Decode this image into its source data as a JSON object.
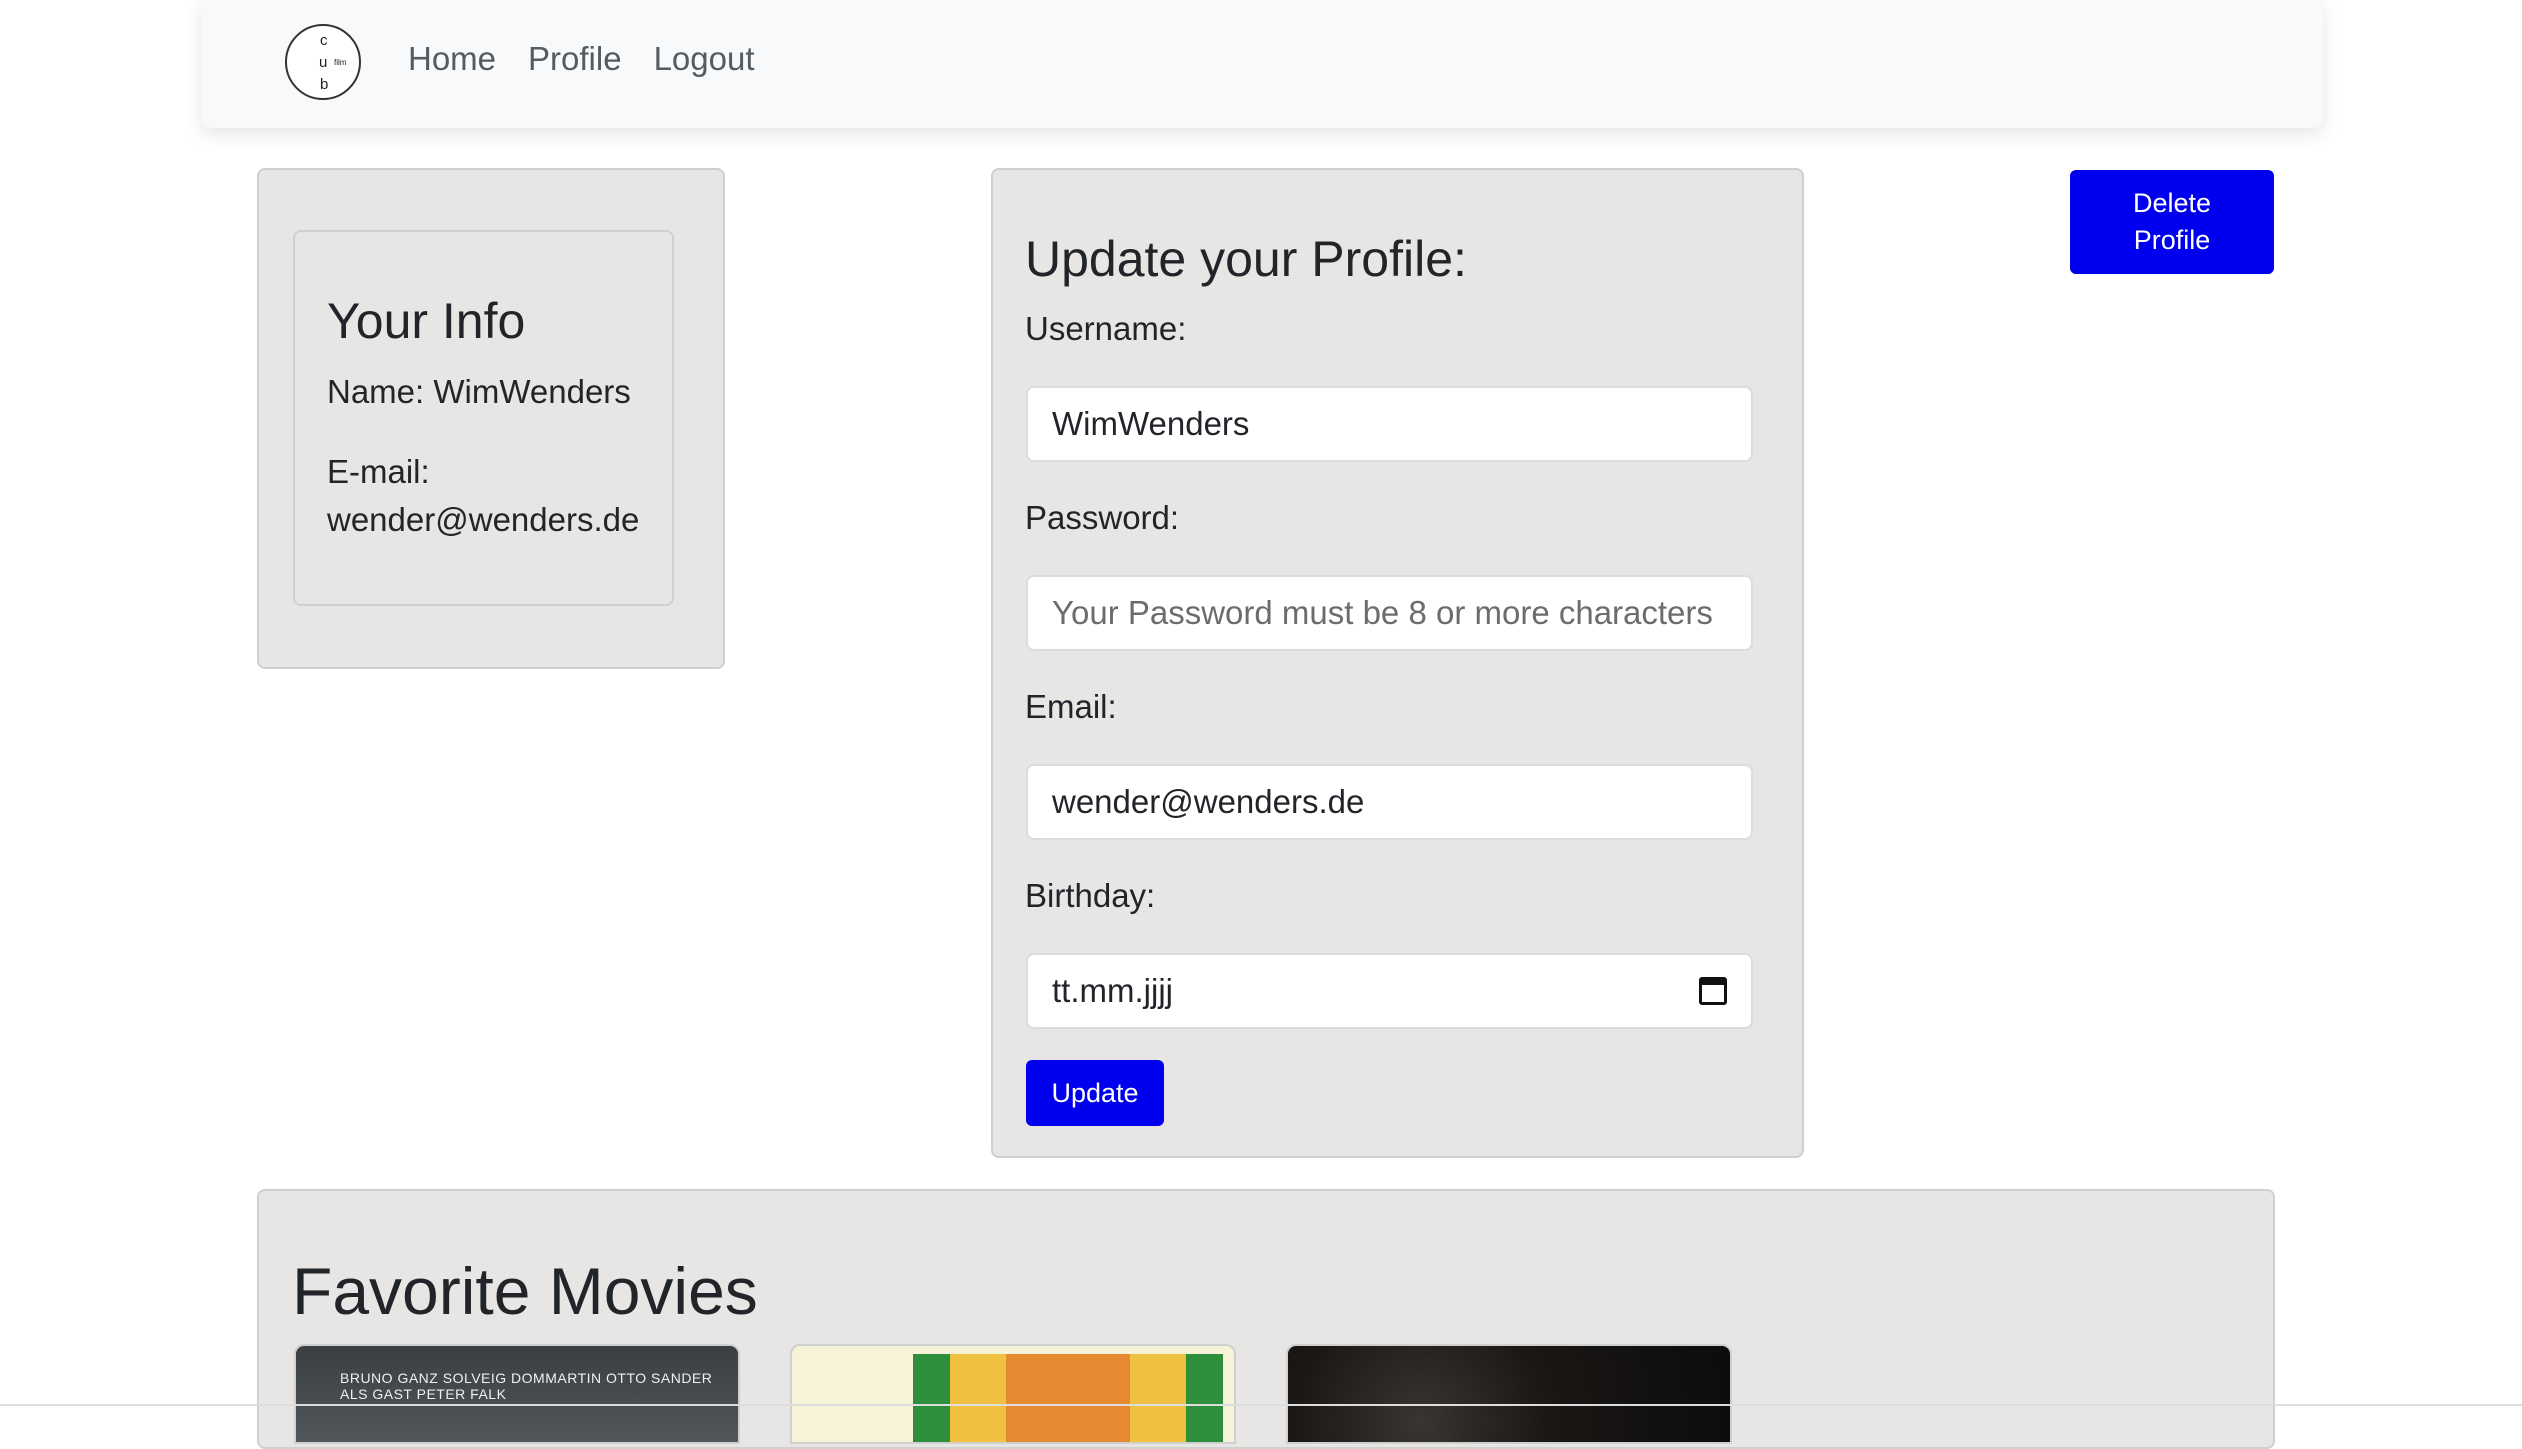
{
  "navbar": {
    "logo": {
      "letters": [
        "c",
        "u",
        "b"
      ],
      "small": "film"
    },
    "links": [
      "Home",
      "Profile",
      "Logout"
    ]
  },
  "info": {
    "title": "Your Info",
    "name_line": "Name: WimWenders",
    "email_label": "E-mail:",
    "email_value": "wender@wenders.de"
  },
  "form": {
    "title": "Update your Profile:",
    "username_label": "Username:",
    "username_value": "WimWenders",
    "password_label": "Password:",
    "password_placeholder": "Your Password must be 8 or more characters",
    "email_label": "Email:",
    "email_value": "wender@wenders.de",
    "birthday_label": "Birthday:",
    "birthday_placeholder": "tt.mm.jjjj",
    "update_label": "Update"
  },
  "delete_button": {
    "label": "Delete\nProfile"
  },
  "favorites": {
    "title": "Favorite Movies",
    "movie1_credits": "BRUNO GANZ   SOLVEIG DOMMARTIN   OTTO SANDER   ALS GAST PETER FALK"
  },
  "colors": {
    "primary_button": "#0000ee",
    "card_bg": "#e7e6e5",
    "navbar_bg": "#f8f9fa"
  }
}
